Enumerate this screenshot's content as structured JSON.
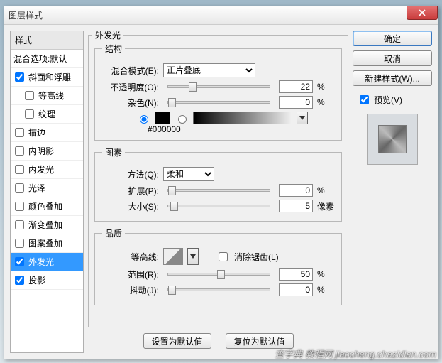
{
  "title": "图层样式",
  "left": {
    "header": "样式",
    "blend": "混合选项:默认",
    "items": [
      {
        "label": "斜面和浮雕",
        "checked": true,
        "indent": false
      },
      {
        "label": "等高线",
        "checked": false,
        "indent": true
      },
      {
        "label": "纹理",
        "checked": false,
        "indent": true
      },
      {
        "label": "描边",
        "checked": false,
        "indent": false
      },
      {
        "label": "内阴影",
        "checked": false,
        "indent": false
      },
      {
        "label": "内发光",
        "checked": false,
        "indent": false
      },
      {
        "label": "光泽",
        "checked": false,
        "indent": false
      },
      {
        "label": "颜色叠加",
        "checked": false,
        "indent": false
      },
      {
        "label": "渐变叠加",
        "checked": false,
        "indent": false
      },
      {
        "label": "图案叠加",
        "checked": false,
        "indent": false
      },
      {
        "label": "外发光",
        "checked": true,
        "indent": false,
        "selected": true
      },
      {
        "label": "投影",
        "checked": true,
        "indent": false
      }
    ]
  },
  "middle": {
    "heading": "外发光",
    "structure": {
      "legend": "结构",
      "blendmode_label": "混合模式(E):",
      "blendmode_value": "正片叠底",
      "opacity_label": "不透明度(O):",
      "opacity_value": "22",
      "opacity_unit": "%",
      "noise_label": "杂色(N):",
      "noise_value": "0",
      "noise_unit": "%",
      "hex": "#000000"
    },
    "elements": {
      "legend": "图素",
      "technique_label": "方法(Q):",
      "technique_value": "柔和",
      "spread_label": "扩展(P):",
      "spread_value": "0",
      "spread_unit": "%",
      "size_label": "大小(S):",
      "size_value": "5",
      "size_unit": "像素"
    },
    "quality": {
      "legend": "品质",
      "contour_label": "等高线:",
      "antialias_label": "消除锯齿(L)",
      "range_label": "范围(R):",
      "range_value": "50",
      "range_unit": "%",
      "jitter_label": "抖动(J):",
      "jitter_value": "0",
      "jitter_unit": "%"
    },
    "buttons": {
      "make_default": "设置为默认值",
      "reset_default": "复位为默认值"
    }
  },
  "right": {
    "ok": "确定",
    "cancel": "取消",
    "newstyle": "新建样式(W)...",
    "preview_label": "预览(V)"
  },
  "watermark": "查字典 教程网 jiaocheng.chazidian.com"
}
